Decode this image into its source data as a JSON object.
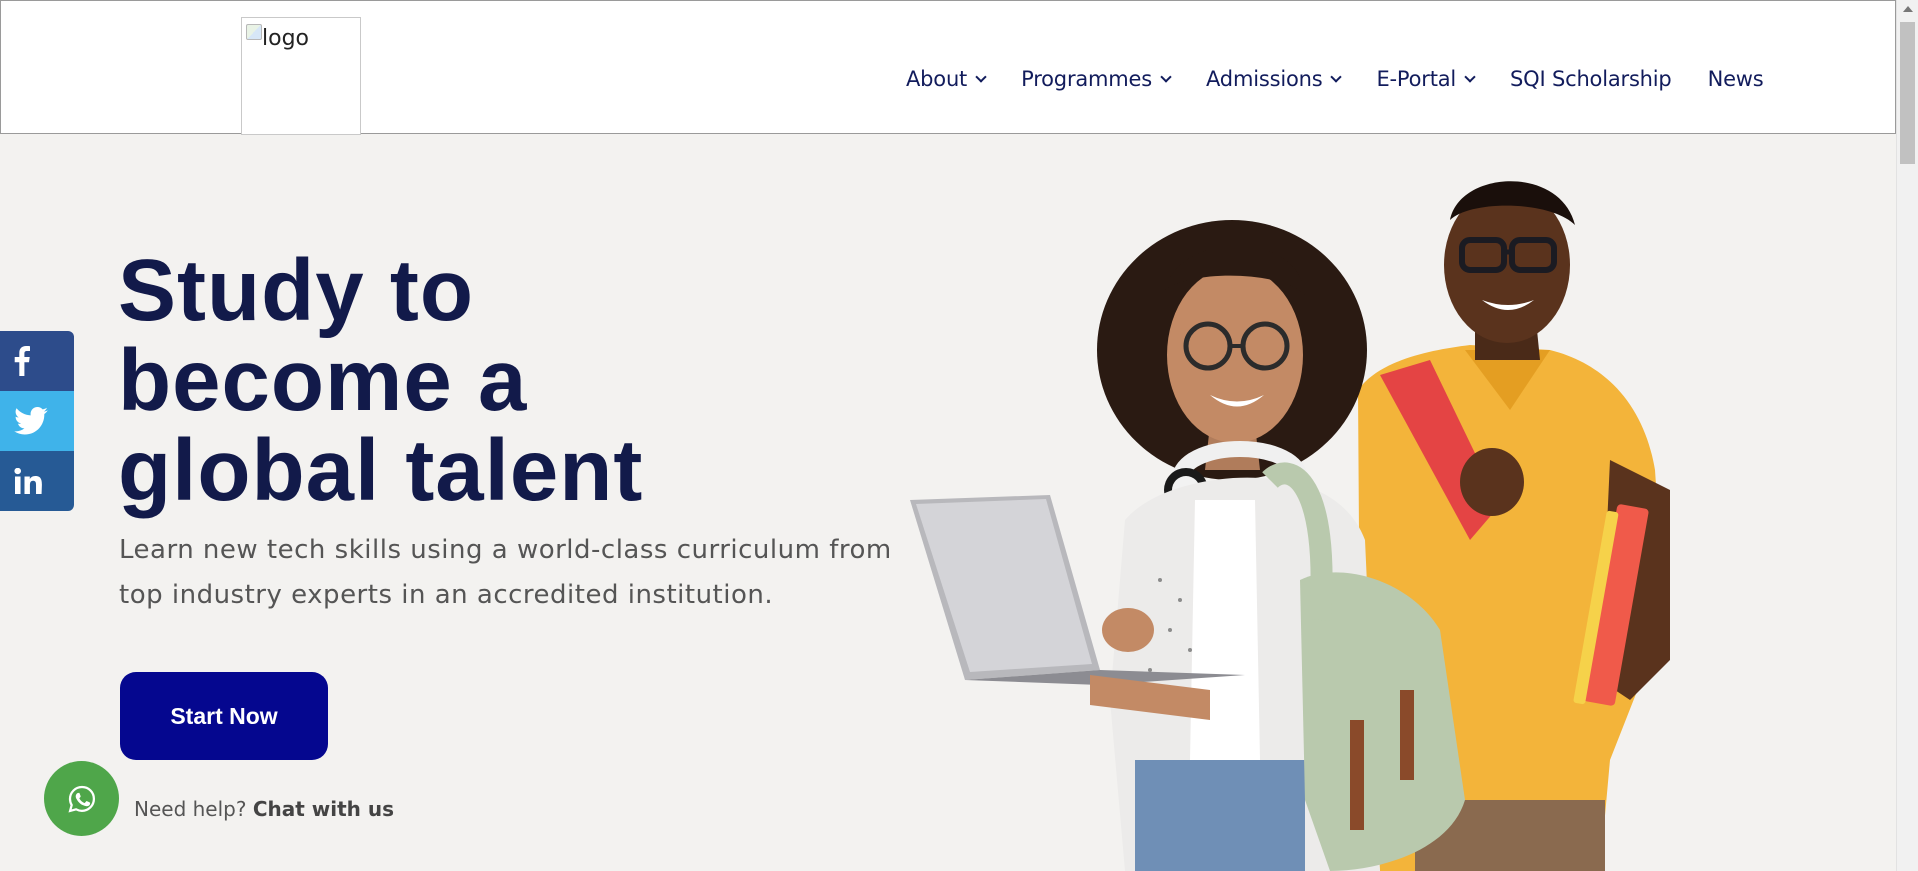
{
  "header": {
    "logo_alt": "logo",
    "nav": [
      {
        "label": "About",
        "dropdown": true
      },
      {
        "label": "Programmes",
        "dropdown": true
      },
      {
        "label": "Admissions",
        "dropdown": true
      },
      {
        "label": "E-Portal",
        "dropdown": true
      },
      {
        "label": "SQI Scholarship",
        "dropdown": false
      },
      {
        "label": "News",
        "dropdown": false
      }
    ]
  },
  "social": [
    {
      "name": "facebook-icon",
      "color": "#2d4c8b"
    },
    {
      "name": "twitter-icon",
      "color": "#3fb3ea"
    },
    {
      "name": "linkedin-icon",
      "color": "#265a95"
    }
  ],
  "hero": {
    "title_lines": [
      "Study to",
      "become a",
      "global talent"
    ],
    "subtitle_line1": "Learn new tech skills using a world-class curriculum from",
    "subtitle_line2": "top industry experts in an accredited institution.",
    "cta_label": "Start Now"
  },
  "chat": {
    "prefix": "Need help?",
    "link": "Chat with us",
    "icon": "whatsapp-icon"
  },
  "colors": {
    "primary_dark": "#121a4a",
    "cta_blue": "#05078f",
    "chat_green": "#4fa64a",
    "page_bg": "#f3f2f0"
  }
}
